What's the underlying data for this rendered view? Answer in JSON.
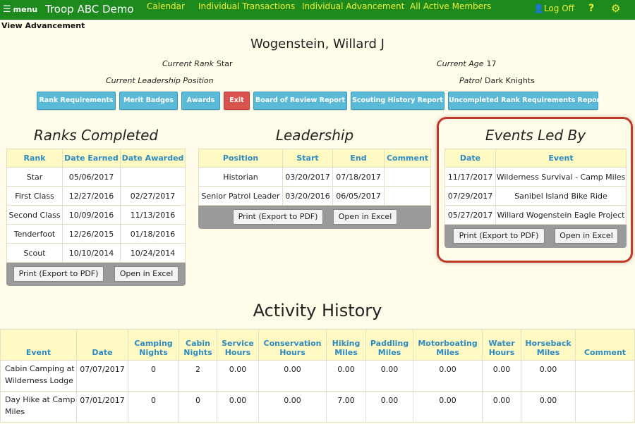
{
  "nav": {
    "menu_label": "menu",
    "brand": "Troop ABC Demo",
    "links": [
      "Calendar",
      "Individual Transactions",
      "Individual Advancement",
      "All Active Members"
    ],
    "logoff": "Log Off",
    "help": "?"
  },
  "page": {
    "view_title": "View Advancement",
    "scout_name": "Wogenstein, Willard J",
    "current_rank_label": "Current Rank",
    "current_rank": "Star",
    "current_age_label": "Current Age",
    "current_age": "17",
    "leadership_label": "Current Leadership Position",
    "leadership": "",
    "patrol_label": "Patrol",
    "patrol": "Dark Knights"
  },
  "buttons": [
    "Rank Requirements",
    "Merit Badges",
    "Awards",
    "Exit",
    "Board of Review Report",
    "Scouting History Report",
    "Uncompleted Rank Requirements Report"
  ],
  "ranks": {
    "title": "Ranks Completed",
    "headers": [
      "Rank",
      "Date Earned",
      "Date Awarded"
    ],
    "rows": [
      [
        "Star",
        "05/06/2017",
        ""
      ],
      [
        "First Class",
        "12/27/2016",
        "02/27/2017"
      ],
      [
        "Second Class",
        "10/09/2016",
        "11/13/2016"
      ],
      [
        "Tenderfoot",
        "12/26/2015",
        "01/18/2016"
      ],
      [
        "Scout",
        "10/10/2014",
        "10/24/2014"
      ]
    ],
    "print_label": "Print (Export to PDF)",
    "excel_label": "Open in Excel"
  },
  "leadership": {
    "title": "Leadership",
    "headers": [
      "Position",
      "Start",
      "End",
      "Comment"
    ],
    "rows": [
      [
        "Historian",
        "03/20/2017",
        "07/18/2017",
        ""
      ],
      [
        "Senior Patrol Leader",
        "03/20/2016",
        "06/05/2017",
        ""
      ]
    ],
    "print_label": "Print (Export to PDF)",
    "excel_label": "Open in Excel"
  },
  "events": {
    "title": "Events Led By",
    "headers": [
      "Date",
      "Event"
    ],
    "rows": [
      [
        "11/17/2017",
        "Wilderness Survival - Camp Miles"
      ],
      [
        "07/29/2017",
        "Sanibel Island Bike Ride"
      ],
      [
        "05/27/2017",
        "Willard Wogenstein Eagle Project"
      ]
    ],
    "print_label": "Print (Export to PDF)",
    "excel_label": "Open in Excel"
  },
  "activity": {
    "title": "Activity History",
    "headers": [
      "Event",
      "Date",
      "Camping Nights",
      "Cabin Nights",
      "Service Hours",
      "Conservation Hours",
      "Hiking Miles",
      "Paddling Miles",
      "Motorboating Miles",
      "Water Hours",
      "Horseback Miles",
      "Comment"
    ],
    "rows": [
      [
        "Cabin Camping at Wilderness Lodge",
        "07/07/2017",
        "0",
        "2",
        "0.00",
        "0.00",
        "0.00",
        "0.00",
        "0.00",
        "0.00",
        "0.00",
        ""
      ],
      [
        "Day Hike at Camp Miles",
        "07/01/2017",
        "0",
        "0",
        "0.00",
        "0.00",
        "7.00",
        "0.00",
        "0.00",
        "0.00",
        "0.00",
        ""
      ]
    ]
  },
  "colors": {
    "nav_bg": "#1d8a1d",
    "nav_link": "#f0f032",
    "button": "#5bbad8",
    "exit_button": "#d9534f",
    "header_text": "#2e8bc0",
    "highlight": "#c0392b"
  }
}
